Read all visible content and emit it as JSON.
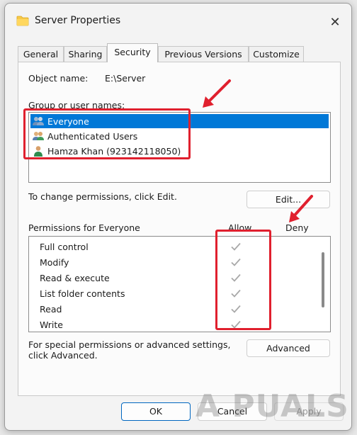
{
  "window": {
    "title": "Server Properties",
    "close_glyph": "✕"
  },
  "tabs": [
    {
      "label": "General",
      "active": false
    },
    {
      "label": "Sharing",
      "active": false
    },
    {
      "label": "Security",
      "active": true
    },
    {
      "label": "Previous Versions",
      "active": false
    },
    {
      "label": "Customize",
      "active": false
    }
  ],
  "security": {
    "object_name_label": "Object name:",
    "object_name_value": "E:\\Server",
    "group_label": "Group or user names:",
    "users": [
      {
        "name": "Everyone",
        "selected": true,
        "icon": "users-group-icon"
      },
      {
        "name": "Authenticated Users",
        "selected": false,
        "icon": "users-group-icon"
      },
      {
        "name": "Hamza Khan (923142118050)",
        "selected": false,
        "icon": "user-icon"
      }
    ],
    "edit_hint": "To change permissions, click Edit.",
    "edit_button": "Edit...",
    "permissions_label": "Permissions for Everyone",
    "allow_label": "Allow",
    "deny_label": "Deny",
    "permissions": [
      {
        "name": "Full control",
        "allow": true,
        "deny": false
      },
      {
        "name": "Modify",
        "allow": true,
        "deny": false
      },
      {
        "name": "Read & execute",
        "allow": true,
        "deny": false
      },
      {
        "name": "List folder contents",
        "allow": true,
        "deny": false
      },
      {
        "name": "Read",
        "allow": true,
        "deny": false
      },
      {
        "name": "Write",
        "allow": true,
        "deny": false
      }
    ],
    "advanced_hint": "For special permissions or advanced settings, click Advanced.",
    "advanced_button": "Advanced"
  },
  "footer": {
    "ok": "OK",
    "cancel": "Cancel",
    "apply": "Apply"
  },
  "watermark": "A PUALS",
  "colors": {
    "selection": "#0078d7",
    "highlight": "#e0202e",
    "check": "#a8a8a8"
  }
}
